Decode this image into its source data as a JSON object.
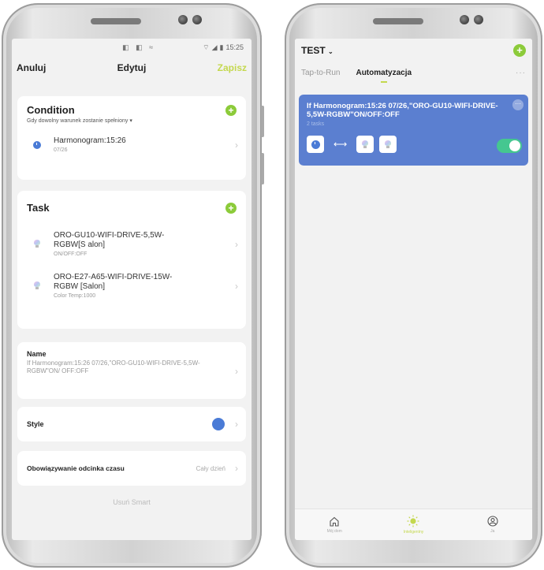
{
  "left_screen": {
    "status": {
      "icons_left": "◧ ◧ ≈",
      "time": "15:25"
    },
    "topbar": {
      "cancel": "Anuluj",
      "title": "Edytuj",
      "save": "Zapisz"
    },
    "condition": {
      "title": "Condition",
      "subtitle": "Gdy dowolny warunek zostanie spełniony ▾",
      "item": {
        "main": "Harmonogram:15:26",
        "sub": "07/26"
      }
    },
    "task": {
      "title": "Task",
      "items": [
        {
          "main": "ORO-GU10-WIFI-DRIVE-5,5W-RGBW[S alon]",
          "sub": "ON/OFF:OFF"
        },
        {
          "main": "ORO-E27-A65-WIFI-DRIVE-15W-RGBW [Salon]",
          "sub": "Color Temp:1000"
        }
      ]
    },
    "name": {
      "title": "Name",
      "value": "If Harmonogram:15:26 07/26,\"ORO-GU10-WIFI-DRIVE-5,5W-RGBW\"ON/ OFF:OFF"
    },
    "style": {
      "title": "Style",
      "color": "#4a7bd6"
    },
    "validity": {
      "title": "Obowiązywanie odcinka czasu",
      "value": "Cały dzień"
    },
    "delete": "Usuń Smart"
  },
  "right_screen": {
    "home": "TEST",
    "tabs": [
      "Tap-to-Run",
      "Automatyzacja"
    ],
    "active_tab": "Automatyzacja",
    "automation": {
      "title": "If Harmonogram:15:26 07/26,\"ORO-GU10-WIFI-DRIVE-5,5W-RGBW\"ON/OFF:OFF",
      "sub": "2 tasks",
      "enabled": true,
      "card_color": "#5b7fd0"
    },
    "nav": [
      {
        "label": "Mój dom",
        "icon": "home-icon"
      },
      {
        "label": "Inteligentny",
        "icon": "sun-icon"
      },
      {
        "label": "Ja",
        "icon": "user-icon"
      }
    ]
  },
  "accent_color": "#c4d84e",
  "plus_color": "#8ccb3a"
}
